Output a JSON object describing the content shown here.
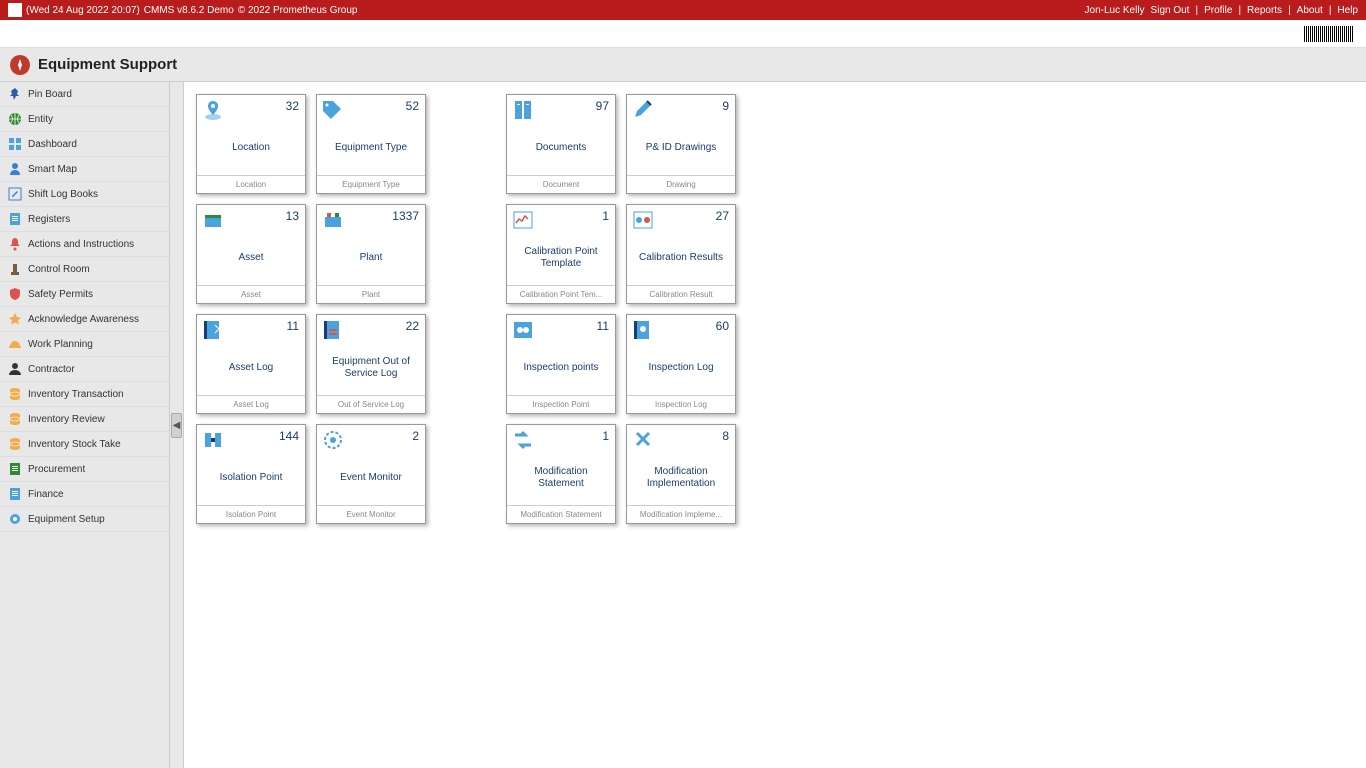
{
  "topbar": {
    "datetime": "(Wed 24 Aug 2022 20:07)",
    "app": "CMMS v8.6.2 Demo",
    "copyright": "© 2022 Prometheus Group",
    "user": "Jon-Luc Kelly",
    "signout": "Sign Out",
    "profile": "Profile",
    "reports": "Reports",
    "about": "About",
    "help": "Help"
  },
  "page_title": "Equipment Support",
  "sidebar": {
    "items": [
      {
        "label": "Pin Board",
        "icon": "pin",
        "icon_color": "#2e5aac"
      },
      {
        "label": "Entity",
        "icon": "globe",
        "icon_color": "#2e8b2e"
      },
      {
        "label": "Dashboard",
        "icon": "dashboard",
        "icon_color": "#4aa3df"
      },
      {
        "label": "Smart Map",
        "icon": "person",
        "icon_color": "#3b7dd8"
      },
      {
        "label": "Shift Log Books",
        "icon": "edit",
        "icon_color": "#3b7dd8"
      },
      {
        "label": "Registers",
        "icon": "doc",
        "icon_color": "#4aa3df"
      },
      {
        "label": "Actions and Instructions",
        "icon": "bell",
        "icon_color": "#d9534f"
      },
      {
        "label": "Control Room",
        "icon": "tower",
        "icon_color": "#7a5c3e"
      },
      {
        "label": "Safety Permits",
        "icon": "shield",
        "icon_color": "#d9534f"
      },
      {
        "label": "Acknowledge Awareness",
        "icon": "star",
        "icon_color": "#f0ad4e"
      },
      {
        "label": "Work Planning",
        "icon": "hardhat",
        "icon_color": "#f0ad4e"
      },
      {
        "label": "Contractor",
        "icon": "user",
        "icon_color": "#333333"
      },
      {
        "label": "Inventory Transaction",
        "icon": "db",
        "icon_color": "#f0ad4e"
      },
      {
        "label": "Inventory Review",
        "icon": "db",
        "icon_color": "#f0ad4e"
      },
      {
        "label": "Inventory Stock Take",
        "icon": "db",
        "icon_color": "#f0ad4e"
      },
      {
        "label": "Procurement",
        "icon": "doc",
        "icon_color": "#2e8b2e"
      },
      {
        "label": "Finance",
        "icon": "doc",
        "icon_color": "#4aa3df"
      },
      {
        "label": "Equipment Setup",
        "icon": "gear",
        "icon_color": "#4aa3df"
      }
    ]
  },
  "cards_left": [
    {
      "title": "Location",
      "count": 32,
      "footer": "Location",
      "icon": "pin-map"
    },
    {
      "title": "Equipment Type",
      "count": 52,
      "footer": "Equipment Type",
      "icon": "tag"
    },
    {
      "title": "Asset",
      "count": 13,
      "footer": "Asset",
      "icon": "asset"
    },
    {
      "title": "Plant",
      "count": 1337,
      "footer": "Plant",
      "icon": "plant"
    },
    {
      "title": "Asset Log",
      "count": 11,
      "footer": "Asset Log",
      "icon": "log"
    },
    {
      "title": "Equipment Out of Service Log",
      "count": 22,
      "footer": "Out of Service Log",
      "icon": "log-red"
    },
    {
      "title": "Isolation Point",
      "count": 144,
      "footer": "Isolation Point",
      "icon": "iso"
    },
    {
      "title": "Event Monitor",
      "count": 2,
      "footer": "Event Monitor",
      "icon": "eye"
    }
  ],
  "cards_right": [
    {
      "title": "Documents",
      "count": 97,
      "footer": "Document",
      "icon": "doc2"
    },
    {
      "title": "P& ID Drawings",
      "count": 9,
      "footer": "Drawing",
      "icon": "pencil"
    },
    {
      "title": "Calibration Point Template",
      "count": 1,
      "footer": "Calibration Point Tem...",
      "icon": "calib"
    },
    {
      "title": "Calibration Results",
      "count": 27,
      "footer": "Calibration Result",
      "icon": "calib-res"
    },
    {
      "title": "Inspection points",
      "count": 11,
      "footer": "Inspection Point",
      "icon": "insp"
    },
    {
      "title": "Inspection Log",
      "count": 60,
      "footer": "Inspection Log",
      "icon": "insp-log"
    },
    {
      "title": "Modification Statement",
      "count": 1,
      "footer": "Modification Statement",
      "icon": "mod"
    },
    {
      "title": "Modification Implementation",
      "count": 8,
      "footer": "Modification Impleme...",
      "icon": "mod-impl"
    }
  ]
}
